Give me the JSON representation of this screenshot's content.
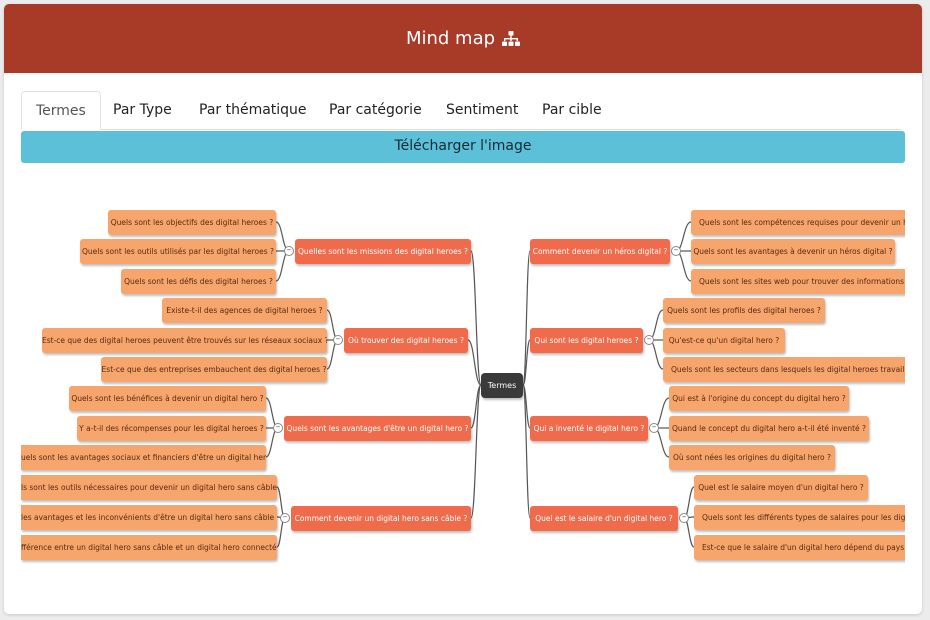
{
  "header": {
    "title": "Mind map",
    "icon": "sitemap-icon"
  },
  "tabs": [
    "Termes",
    "Par Type",
    "Par thématique",
    "Par catégorie",
    "Sentiment",
    "Par cible"
  ],
  "download_label": "Télécharger l'image",
  "mindmap": {
    "root": "Termes",
    "left": [
      {
        "label": "Quelles sont les missions des digital heroes ?",
        "children": [
          "Quels sont les objectifs des digital heroes ?",
          "Quels sont les outils utilisés par les digital heroes ?",
          "Quels sont les défis des digital heroes ?"
        ]
      },
      {
        "label": "Où trouver des digital heroes ?",
        "children": [
          "Existe-t-il des agences de digital heroes ?",
          "Est-ce que des digital heroes peuvent être trouvés sur les réseaux sociaux ?",
          "Est-ce que des entreprises embauchent des digital heroes ?"
        ]
      },
      {
        "label": "Quels sont les avantages d'être un digital hero ?",
        "children": [
          "Quels sont les bénéfices à devenir un digital hero ?",
          "Y a-t-il des récompenses pour les digital heroes ?",
          "uels sont les avantages sociaux et financiers d'être un digital hero ?"
        ]
      },
      {
        "label": "Comment devenir un digital hero sans câble ?",
        "children": [
          "ls sont les outils nécessaires pour devenir un digital hero sans câble ?",
          "les avantages et les inconvénients d'être un digital hero sans câble ?",
          "fférence entre un digital hero sans câble et un digital hero connecté ?"
        ]
      }
    ],
    "right": [
      {
        "label": "Comment devenir un héros digital ?",
        "children": [
          "Quels sont les compétences requises pour devenir un héros",
          "Quels sont les avantages à devenir un héros digital ?",
          "Quels sont les sites web pour trouver des informations sur"
        ]
      },
      {
        "label": "Qui sont les digital heroes ?",
        "children": [
          "Quels sont les profils des digital heroes ?",
          "Qu'est-ce qu'un digital hero ?",
          "Quels sont les secteurs dans lesquels les digital heroes travaillent ?"
        ]
      },
      {
        "label": "Qui a inventé le digital hero ?",
        "children": [
          "Qui est à l'origine du concept du digital hero ?",
          "Quand le concept du digital hero a-t-il été inventé ?",
          "Où sont nées les origines du digital hero ?"
        ]
      },
      {
        "label": "Quel est le salaire d'un digital hero ?",
        "children": [
          "Quel est le salaire moyen d'un digital hero ?",
          "Quels sont les différents types de salaires pour les digital l",
          "Est-ce que le salaire d'un digital hero dépend du pays ?"
        ]
      }
    ]
  },
  "colors": {
    "header": "#a83a28",
    "download": "#5bc0d8",
    "leaf": "#f6a56c",
    "branch": "#ef6b4b",
    "root": "#3a3a3a"
  }
}
